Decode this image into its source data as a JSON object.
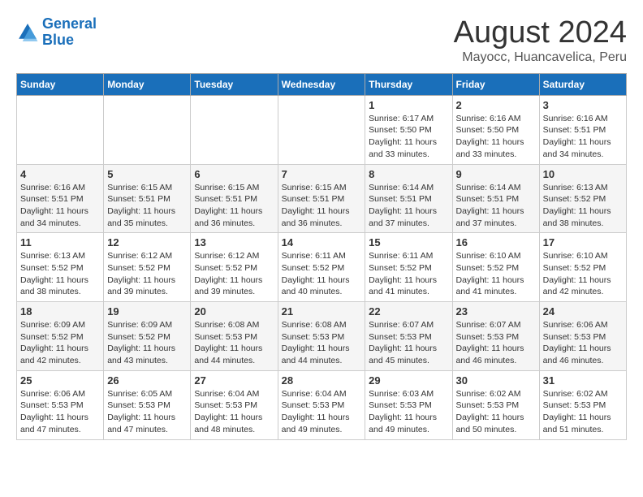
{
  "logo": {
    "line1": "General",
    "line2": "Blue"
  },
  "title": "August 2024",
  "subtitle": "Mayocc, Huancavelica, Peru",
  "headers": [
    "Sunday",
    "Monday",
    "Tuesday",
    "Wednesday",
    "Thursday",
    "Friday",
    "Saturday"
  ],
  "weeks": [
    [
      {
        "day": "",
        "detail": ""
      },
      {
        "day": "",
        "detail": ""
      },
      {
        "day": "",
        "detail": ""
      },
      {
        "day": "",
        "detail": ""
      },
      {
        "day": "1",
        "detail": "Sunrise: 6:17 AM\nSunset: 5:50 PM\nDaylight: 11 hours\nand 33 minutes."
      },
      {
        "day": "2",
        "detail": "Sunrise: 6:16 AM\nSunset: 5:50 PM\nDaylight: 11 hours\nand 33 minutes."
      },
      {
        "day": "3",
        "detail": "Sunrise: 6:16 AM\nSunset: 5:51 PM\nDaylight: 11 hours\nand 34 minutes."
      }
    ],
    [
      {
        "day": "4",
        "detail": "Sunrise: 6:16 AM\nSunset: 5:51 PM\nDaylight: 11 hours\nand 34 minutes."
      },
      {
        "day": "5",
        "detail": "Sunrise: 6:15 AM\nSunset: 5:51 PM\nDaylight: 11 hours\nand 35 minutes."
      },
      {
        "day": "6",
        "detail": "Sunrise: 6:15 AM\nSunset: 5:51 PM\nDaylight: 11 hours\nand 36 minutes."
      },
      {
        "day": "7",
        "detail": "Sunrise: 6:15 AM\nSunset: 5:51 PM\nDaylight: 11 hours\nand 36 minutes."
      },
      {
        "day": "8",
        "detail": "Sunrise: 6:14 AM\nSunset: 5:51 PM\nDaylight: 11 hours\nand 37 minutes."
      },
      {
        "day": "9",
        "detail": "Sunrise: 6:14 AM\nSunset: 5:51 PM\nDaylight: 11 hours\nand 37 minutes."
      },
      {
        "day": "10",
        "detail": "Sunrise: 6:13 AM\nSunset: 5:52 PM\nDaylight: 11 hours\nand 38 minutes."
      }
    ],
    [
      {
        "day": "11",
        "detail": "Sunrise: 6:13 AM\nSunset: 5:52 PM\nDaylight: 11 hours\nand 38 minutes."
      },
      {
        "day": "12",
        "detail": "Sunrise: 6:12 AM\nSunset: 5:52 PM\nDaylight: 11 hours\nand 39 minutes."
      },
      {
        "day": "13",
        "detail": "Sunrise: 6:12 AM\nSunset: 5:52 PM\nDaylight: 11 hours\nand 39 minutes."
      },
      {
        "day": "14",
        "detail": "Sunrise: 6:11 AM\nSunset: 5:52 PM\nDaylight: 11 hours\nand 40 minutes."
      },
      {
        "day": "15",
        "detail": "Sunrise: 6:11 AM\nSunset: 5:52 PM\nDaylight: 11 hours\nand 41 minutes."
      },
      {
        "day": "16",
        "detail": "Sunrise: 6:10 AM\nSunset: 5:52 PM\nDaylight: 11 hours\nand 41 minutes."
      },
      {
        "day": "17",
        "detail": "Sunrise: 6:10 AM\nSunset: 5:52 PM\nDaylight: 11 hours\nand 42 minutes."
      }
    ],
    [
      {
        "day": "18",
        "detail": "Sunrise: 6:09 AM\nSunset: 5:52 PM\nDaylight: 11 hours\nand 42 minutes."
      },
      {
        "day": "19",
        "detail": "Sunrise: 6:09 AM\nSunset: 5:52 PM\nDaylight: 11 hours\nand 43 minutes."
      },
      {
        "day": "20",
        "detail": "Sunrise: 6:08 AM\nSunset: 5:53 PM\nDaylight: 11 hours\nand 44 minutes."
      },
      {
        "day": "21",
        "detail": "Sunrise: 6:08 AM\nSunset: 5:53 PM\nDaylight: 11 hours\nand 44 minutes."
      },
      {
        "day": "22",
        "detail": "Sunrise: 6:07 AM\nSunset: 5:53 PM\nDaylight: 11 hours\nand 45 minutes."
      },
      {
        "day": "23",
        "detail": "Sunrise: 6:07 AM\nSunset: 5:53 PM\nDaylight: 11 hours\nand 46 minutes."
      },
      {
        "day": "24",
        "detail": "Sunrise: 6:06 AM\nSunset: 5:53 PM\nDaylight: 11 hours\nand 46 minutes."
      }
    ],
    [
      {
        "day": "25",
        "detail": "Sunrise: 6:06 AM\nSunset: 5:53 PM\nDaylight: 11 hours\nand 47 minutes."
      },
      {
        "day": "26",
        "detail": "Sunrise: 6:05 AM\nSunset: 5:53 PM\nDaylight: 11 hours\nand 47 minutes."
      },
      {
        "day": "27",
        "detail": "Sunrise: 6:04 AM\nSunset: 5:53 PM\nDaylight: 11 hours\nand 48 minutes."
      },
      {
        "day": "28",
        "detail": "Sunrise: 6:04 AM\nSunset: 5:53 PM\nDaylight: 11 hours\nand 49 minutes."
      },
      {
        "day": "29",
        "detail": "Sunrise: 6:03 AM\nSunset: 5:53 PM\nDaylight: 11 hours\nand 49 minutes."
      },
      {
        "day": "30",
        "detail": "Sunrise: 6:02 AM\nSunset: 5:53 PM\nDaylight: 11 hours\nand 50 minutes."
      },
      {
        "day": "31",
        "detail": "Sunrise: 6:02 AM\nSunset: 5:53 PM\nDaylight: 11 hours\nand 51 minutes."
      }
    ]
  ]
}
